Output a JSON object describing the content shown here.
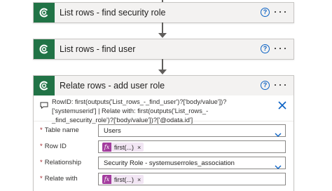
{
  "flow": {
    "steps": [
      {
        "title": "List rows - find security role"
      },
      {
        "title": "List rows - find user"
      },
      {
        "title": "Relate rows - add user role",
        "info_text": "RowID: first(outputs('List_rows_-_find_user')?['body/value'])?['systemuserid'] | Relate with: first(outputs('List_rows_-_find_security_role')?['body/value'])?['@odata.id']",
        "fields": [
          {
            "label": "Table name",
            "value": "Users",
            "type": "dropdown"
          },
          {
            "label": "Row ID",
            "token": "first(...)",
            "type": "token"
          },
          {
            "label": "Relationship",
            "value": "Security Role - systemuserroles_association",
            "type": "dropdown"
          },
          {
            "label": "Relate with",
            "token": "first(...)",
            "type": "token"
          }
        ]
      }
    ]
  },
  "ui": {
    "required_marker": "*",
    "help_glyph": "?",
    "more_glyph": "···",
    "token_icon_glyph": "fx",
    "token_remove_glyph": "×"
  },
  "colors": {
    "dataverse_green": "#217346",
    "help_blue": "#0b62c4",
    "expression_purple": "#a33d9e",
    "token_bg": "#f2e6f4",
    "required_red": "#a4262c"
  },
  "icons": {
    "step_icon": "dataverse-icon",
    "help": "help-icon",
    "more": "more-options-icon",
    "info": "comment-icon",
    "close": "close-icon",
    "dropdown": "chevron-down-icon",
    "token": "expression-icon"
  }
}
